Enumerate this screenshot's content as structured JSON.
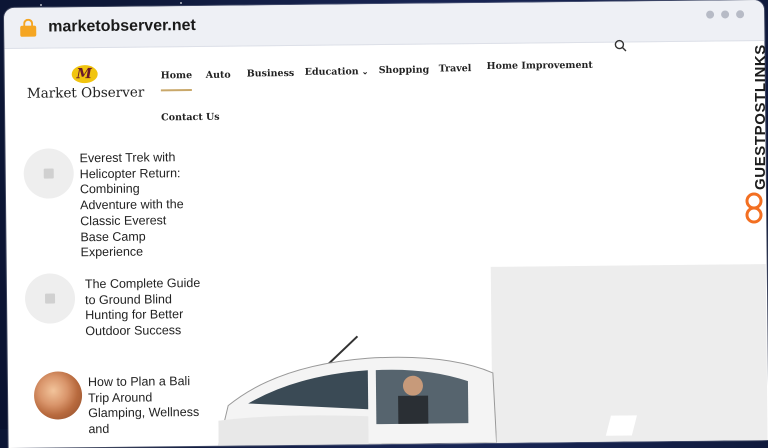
{
  "browser": {
    "url": "marketobserver.net"
  },
  "site": {
    "logo_mark": "M",
    "logo_text": "Market Observer"
  },
  "nav": {
    "items": [
      {
        "label": "Home"
      },
      {
        "label": "Auto"
      },
      {
        "label": "Business"
      },
      {
        "label": "Education"
      },
      {
        "label": "Shopping"
      },
      {
        "label": "Travel"
      },
      {
        "label": "Home Improvement"
      },
      {
        "label": "Contact Us"
      }
    ],
    "active": "Home"
  },
  "posts": [
    {
      "title": "Everest Trek with Helicopter Return: Combining Adventure with the Classic Everest Base Camp Experience"
    },
    {
      "title": "The Complete Guide to Ground Blind Hunting for Better Outdoor Success"
    },
    {
      "title": "How to Plan a Bali Trip Around Glamping, Wellness and"
    }
  ],
  "watermark": {
    "text": "GUESTPOSTLINKS"
  },
  "colors": {
    "accent": "#c9a86a",
    "lock": "#f5a623",
    "logo_mark": "#f1c40f",
    "watermark_logo": "#f36f21"
  }
}
